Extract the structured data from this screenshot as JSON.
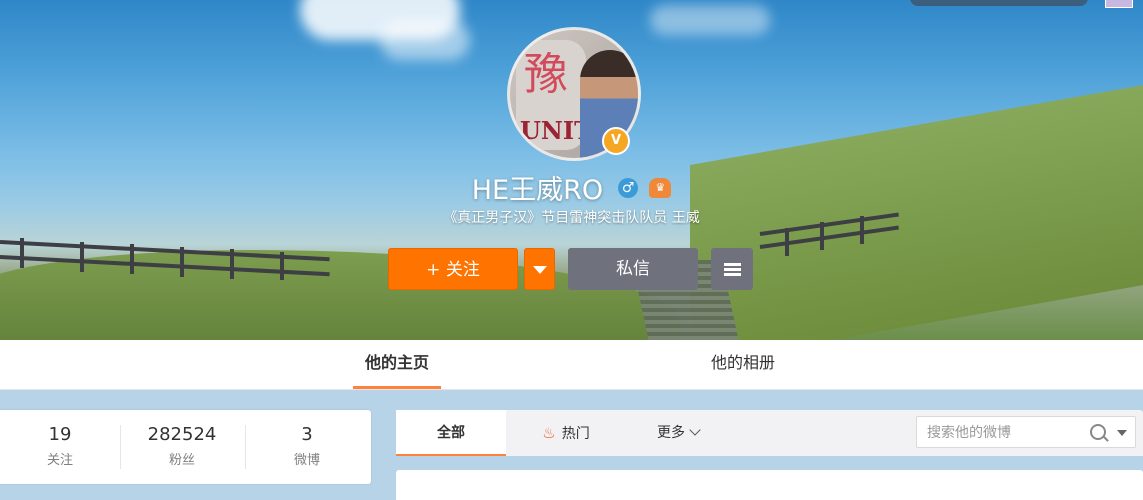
{
  "profile": {
    "name": "HE王威RO",
    "bio": "《真正男子汉》节目雷神突击队队员 王威",
    "gender_symbol": "♂",
    "verified_badge": "V",
    "avatar_text": {
      "mark": "豫",
      "unit": "UNIT"
    }
  },
  "actions": {
    "follow_label": "+ 关注",
    "message_label": "私信"
  },
  "tabs": {
    "home": "他的主页",
    "album": "他的相册"
  },
  "stats": [
    {
      "value": "19",
      "label": "关注"
    },
    {
      "value": "282524",
      "label": "粉丝"
    },
    {
      "value": "3",
      "label": "微博"
    }
  ],
  "feed_tabs": {
    "all": "全部",
    "hot": "热门",
    "more": "更多"
  },
  "search": {
    "placeholder": "搜索他的微博",
    "value": ""
  },
  "icons": {
    "flame": "flame-icon",
    "search": "search-icon",
    "menu": "menu-icon",
    "dropdown": "chevron-down-icon"
  },
  "colors": {
    "accent_orange": "#ff7300",
    "tab_underline": "#ff8140",
    "secondary_button": "#6f717c"
  }
}
